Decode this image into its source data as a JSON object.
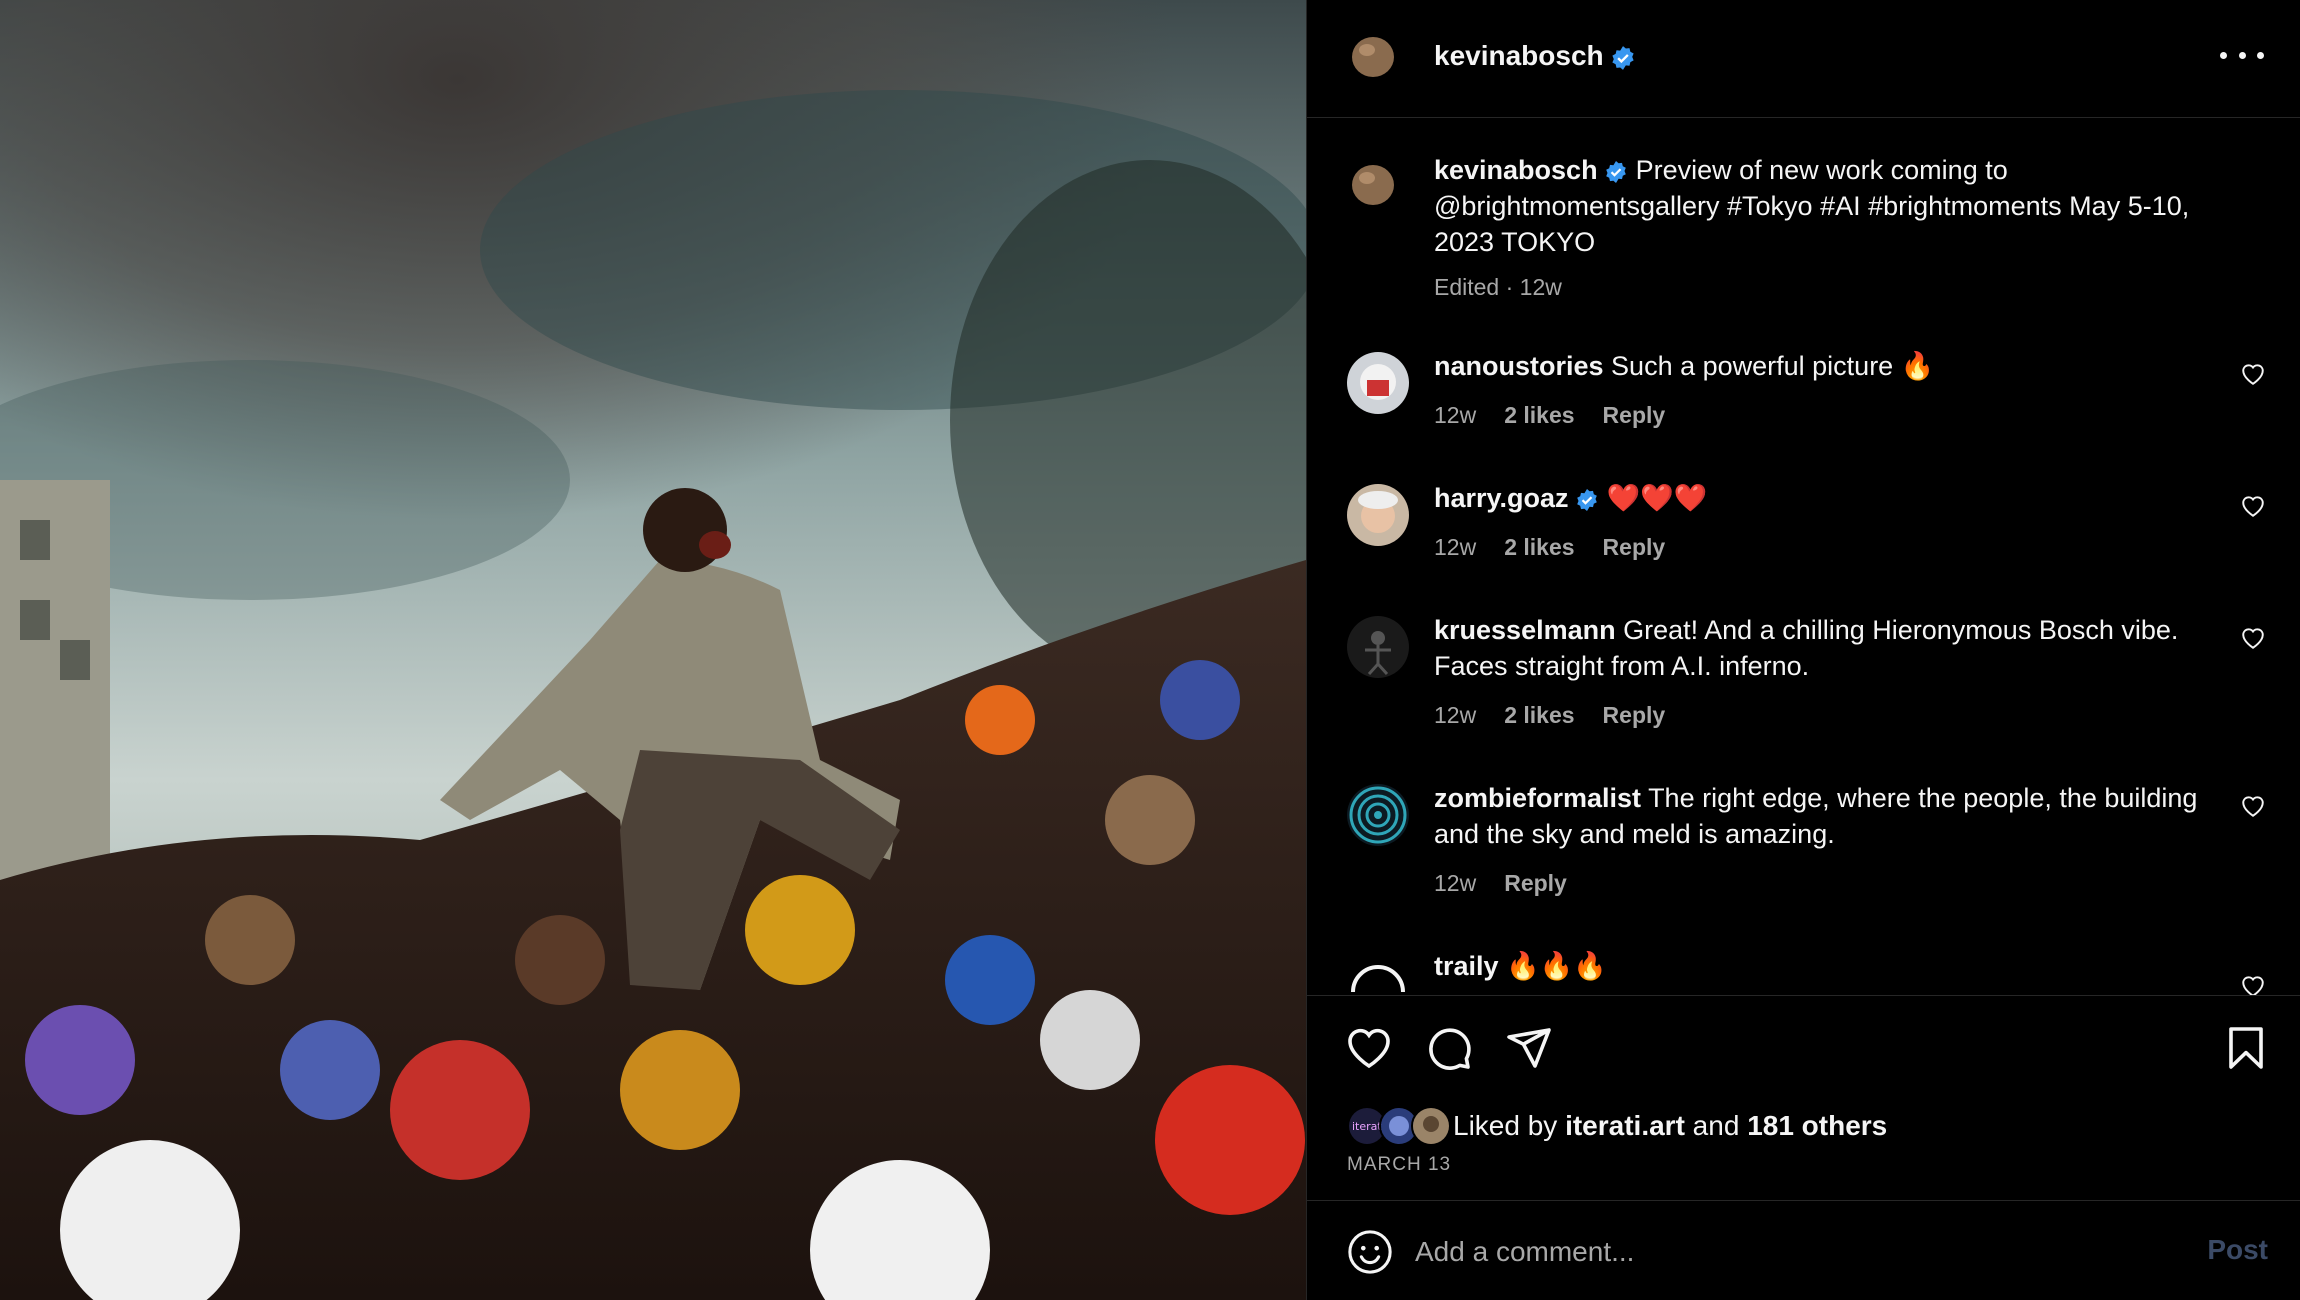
{
  "post": {
    "username": "kevinabosch",
    "verified": true,
    "caption": "Preview of new work coming to @brightmomentsgallery #Tokyo #AI #brightmoments May 5-10, 2023 TOKYO",
    "caption_meta": "Edited · 12w",
    "image_icon": "photo-crowd-artwork"
  },
  "comments": [
    {
      "username": "nanoustories",
      "verified": false,
      "text": "Such a powerful picture 🔥",
      "time": "12w",
      "likes": "2 likes",
      "reply": "Reply"
    },
    {
      "username": "harry.goaz",
      "verified": true,
      "text": "❤️❤️❤️",
      "time": "12w",
      "likes": "2 likes",
      "reply": "Reply"
    },
    {
      "username": "kruesselmann",
      "verified": false,
      "text": "Great! And a chilling Hieronymous Bosch vibe. Faces straight from A.I. inferno.",
      "time": "12w",
      "likes": "2 likes",
      "reply": "Reply"
    },
    {
      "username": "zombieformalist",
      "verified": false,
      "text": "The right edge, where the people, the building and the sky and meld is amazing.",
      "time": "12w",
      "likes": "",
      "reply": "Reply"
    },
    {
      "username": "traily",
      "verified": false,
      "text": "🔥🔥🔥",
      "time": "",
      "likes": "",
      "reply": ""
    }
  ],
  "actions": {
    "icons": [
      "heart-icon",
      "comment-icon",
      "share-icon",
      "bookmark-icon"
    ]
  },
  "likes": {
    "prefix": "Liked by ",
    "user": "iterati.art",
    "middle": " and ",
    "others": "181 others",
    "avatar_label": "iterati"
  },
  "date": "MARCH 13",
  "add_comment": {
    "placeholder": "Add a comment...",
    "post_label": "Post"
  },
  "colors": {
    "background": "#000000",
    "text": "#f5f5f5",
    "secondary": "#a8a8a8",
    "verified": "#3897f0",
    "post_button_disabled": "#3b4a66"
  }
}
